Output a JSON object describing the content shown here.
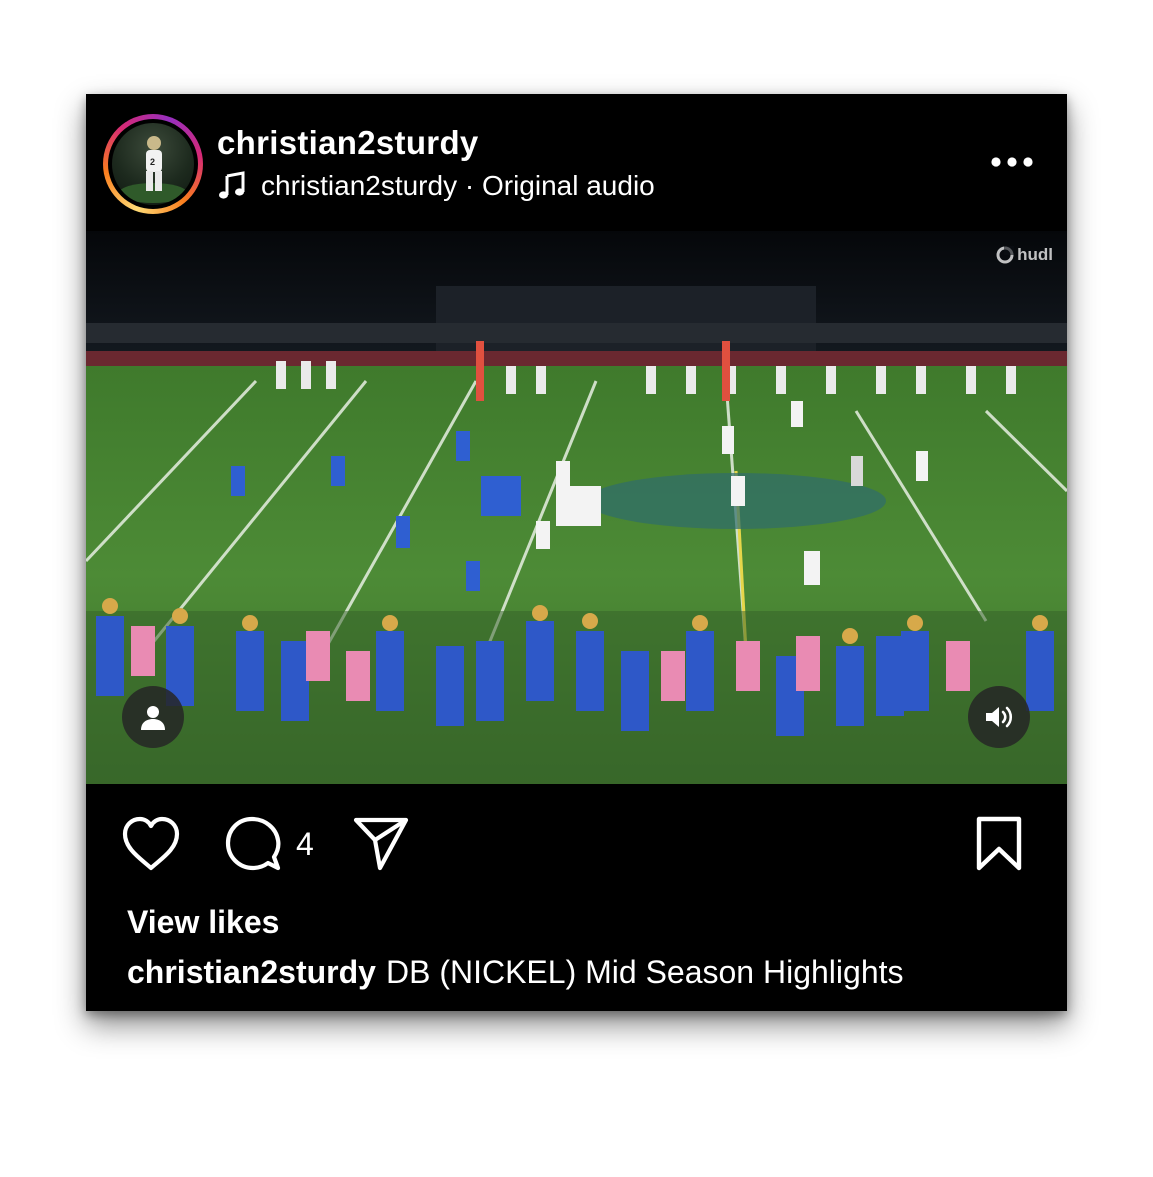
{
  "post": {
    "username": "christian2sturdy",
    "audio": {
      "icon": "music-note-icon",
      "text": "christian2sturdy · Original audio"
    },
    "menu_icon": "more-horizontal-icon"
  },
  "video": {
    "watermark": "hudl",
    "tag_icon": "person-icon",
    "sound_icon": "speaker-icon"
  },
  "actions": {
    "like_icon": "heart-icon",
    "comment_icon": "comment-icon",
    "comment_count": "4",
    "share_icon": "send-icon",
    "save_icon": "bookmark-icon"
  },
  "view_likes": "View likes",
  "caption": {
    "username": "christian2sturdy",
    "text": "DB (NICKEL) Mid Season Highlights"
  },
  "colors": {
    "background": "#000000",
    "text": "#ffffff",
    "ring_gradient": [
      "#feda75",
      "#fa7e1e",
      "#d62976",
      "#962fbf"
    ],
    "field": "#4f8a3a"
  }
}
